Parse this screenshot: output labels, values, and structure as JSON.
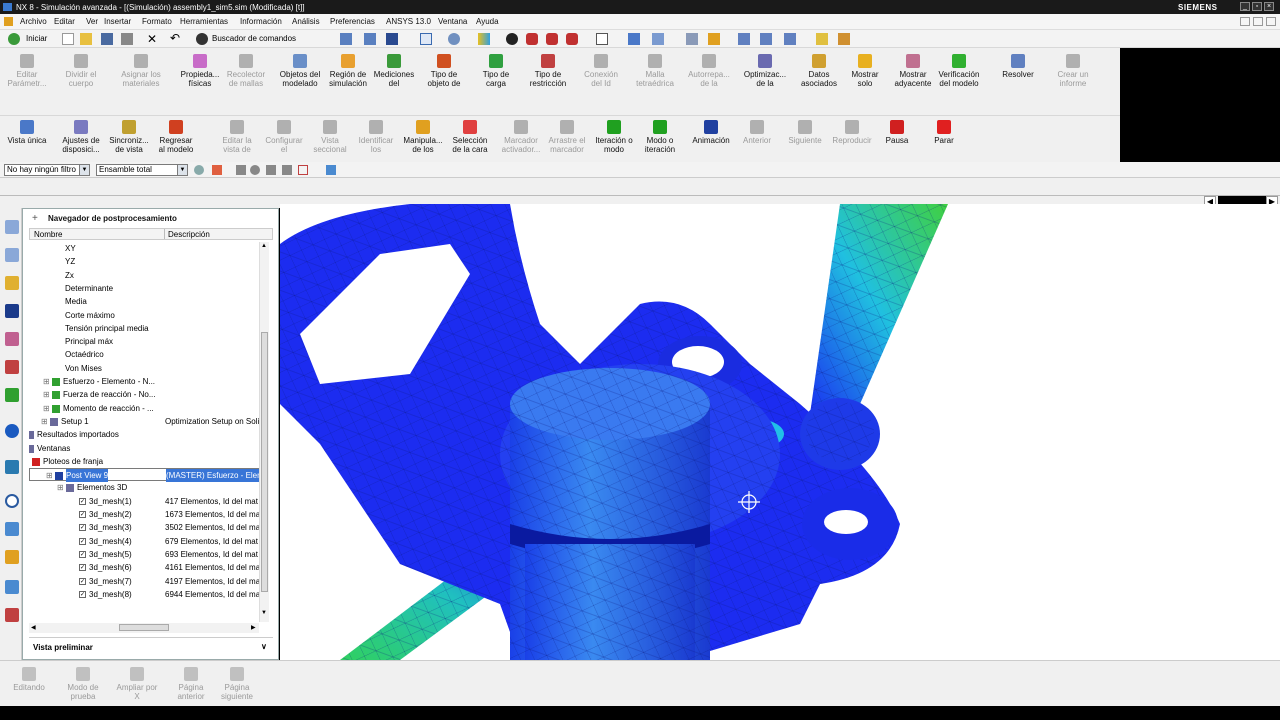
{
  "window": {
    "title": "NX 8 - Simulación avanzada - [(Simulación) assembly1_sim5.sim (Modificada)    [t]]",
    "brand": "SIEMENS"
  },
  "menu": [
    "Archivo",
    "Editar",
    "Ver",
    "Insertar",
    "Formato",
    "Herramientas",
    "Información",
    "Análisis",
    "Preferencias",
    "ANSYS 13.0",
    "Ventana",
    "Ayuda"
  ],
  "toolbar1": {
    "start": "Iniciar",
    "command_finder": "Buscador de comandos"
  },
  "ribbon1": [
    {
      "label": "Editar\nParámetr...",
      "enabled": false,
      "color": "#b0b0b0"
    },
    {
      "label": "Dividir el\ncuerpo",
      "enabled": false,
      "color": "#b0b0b0"
    },
    {
      "label": "Asignar los\nmateriales",
      "enabled": false,
      "color": "#b0b0b0"
    },
    {
      "label": "Propieda...\nfísicas",
      "enabled": true,
      "color": "#c86cc8"
    },
    {
      "label": "Recolector\nde mallas",
      "enabled": false,
      "color": "#b0b0b0"
    },
    {
      "label": "Objetos del\nmodelado",
      "enabled": true,
      "color": "#6a8fc8"
    },
    {
      "label": "Región de\nsimulación",
      "enabled": true,
      "color": "#e8a030"
    },
    {
      "label": "Mediciones\ndel",
      "enabled": true,
      "color": "#3a9a3a"
    },
    {
      "label": "Tipo de\nobjeto de",
      "enabled": true,
      "color": "#d05020"
    },
    {
      "label": "Tipo de\ncarga",
      "enabled": true,
      "color": "#30a040"
    },
    {
      "label": "Tipo de\nrestricción",
      "enabled": true,
      "color": "#c04040"
    },
    {
      "label": "Conexión\ndel Id",
      "enabled": false,
      "color": "#b0b0b0"
    },
    {
      "label": "Malla\ntetraédrica",
      "enabled": false,
      "color": "#b0b0b0"
    },
    {
      "label": "Autorrepa...\nde la",
      "enabled": false,
      "color": "#b0b0b0"
    },
    {
      "label": "Optimizac...\nde la",
      "enabled": true,
      "color": "#6a6ab0"
    },
    {
      "label": "Datos\nasociados",
      "enabled": true,
      "color": "#d0a030"
    },
    {
      "label": "Mostrar\nsolo",
      "enabled": true,
      "color": "#e8b020"
    },
    {
      "label": "Mostrar\nadyacente",
      "enabled": true,
      "color": "#c07090"
    },
    {
      "label": "Verificación\ndel modelo",
      "enabled": true,
      "color": "#30b030"
    },
    {
      "label": "Resolver",
      "enabled": true,
      "color": "#6080c0"
    },
    {
      "label": "Crear un\ninforme",
      "enabled": false,
      "color": "#b0b0b0"
    }
  ],
  "ribbon2": [
    {
      "label": "Vista única",
      "enabled": true,
      "color": "#4a78c8"
    },
    {
      "label": "Ajustes de\ndisposici...",
      "enabled": true,
      "color": "#7a7ac0"
    },
    {
      "label": "Sincroniz...\nde vista",
      "enabled": true,
      "color": "#c0a030"
    },
    {
      "label": "Regresar\nal modelo",
      "enabled": true,
      "color": "#d04020"
    },
    {
      "label": "Editar la\nvista de",
      "enabled": false,
      "color": "#b0b0b0"
    },
    {
      "label": "Configurar\nel",
      "enabled": false,
      "color": "#b0b0b0"
    },
    {
      "label": "Vista\nseccional",
      "enabled": false,
      "color": "#b0b0b0"
    },
    {
      "label": "Identificar\nlos",
      "enabled": false,
      "color": "#b0b0b0"
    },
    {
      "label": "Manipula...\nde los",
      "enabled": true,
      "color": "#e0a020"
    },
    {
      "label": "Selección\nde la cara",
      "enabled": true,
      "color": "#e04040"
    },
    {
      "label": "Marcador\nactivador...",
      "enabled": false,
      "color": "#b0b0b0"
    },
    {
      "label": "Arrastre el\nmarcador",
      "enabled": false,
      "color": "#b0b0b0"
    },
    {
      "label": "Iteración o\nmodo",
      "enabled": true,
      "color": "#20a020"
    },
    {
      "label": "Modo o\niteración",
      "enabled": true,
      "color": "#20a020"
    },
    {
      "label": "Animación",
      "enabled": true,
      "color": "#2040a0"
    },
    {
      "label": "Anterior",
      "enabled": false,
      "color": "#b0b0b0"
    },
    {
      "label": "Siguiente",
      "enabled": false,
      "color": "#b0b0b0"
    },
    {
      "label": "Reproducir",
      "enabled": false,
      "color": "#b0b0b0"
    },
    {
      "label": "Pausa",
      "enabled": true,
      "color": "#d02020"
    },
    {
      "label": "Parar",
      "enabled": true,
      "color": "#e02020"
    }
  ],
  "filter": {
    "filter_value": "No hay ningún filtro",
    "assembly_value": "Ensamble total"
  },
  "navigator": {
    "title": "Navegador de postprocesamiento",
    "col_name": "Nombre",
    "col_desc": "Descripción",
    "rows": [
      {
        "name": "XY",
        "desc": "",
        "indent": 36
      },
      {
        "name": "YZ",
        "desc": "",
        "indent": 36
      },
      {
        "name": "Zx",
        "desc": "",
        "indent": 36
      },
      {
        "name": "Determinante",
        "desc": "",
        "indent": 36
      },
      {
        "name": "Media",
        "desc": "",
        "indent": 36
      },
      {
        "name": "Corte máximo",
        "desc": "",
        "indent": 36
      },
      {
        "name": "Tensión principal media",
        "desc": "",
        "indent": 36
      },
      {
        "name": "Principal máx",
        "desc": "",
        "indent": 36
      },
      {
        "name": "Octaédrico",
        "desc": "",
        "indent": 36
      },
      {
        "name": "Von Mises",
        "desc": "",
        "indent": 36
      },
      {
        "name": "Esfuerzo - Elemento - N...",
        "desc": "",
        "indent": 34
      },
      {
        "name": "Fuerza de reacción - No...",
        "desc": "",
        "indent": 34
      },
      {
        "name": "Momento de reacción - ...",
        "desc": "",
        "indent": 34
      },
      {
        "name": "Setup 1",
        "desc": "Optimization Setup on Soli",
        "indent": 32
      },
      {
        "name": "Resultados importados",
        "desc": "",
        "indent": 8
      },
      {
        "name": "Ventanas",
        "desc": "",
        "indent": 8
      },
      {
        "name": "Ploteos de franja",
        "desc": "",
        "indent": 14
      },
      {
        "name": "Post View 9",
        "desc": "(MASTER) Esfuerzo - Elem",
        "indent": 36
      },
      {
        "name": "Elementos 3D",
        "desc": "",
        "indent": 48
      },
      {
        "name": "3d_mesh(1)",
        "desc": "417 Elementos, Id del mat",
        "indent": 60
      },
      {
        "name": "3d_mesh(2)",
        "desc": "1673 Elementos, Id del ma",
        "indent": 60
      },
      {
        "name": "3d_mesh(3)",
        "desc": "3502 Elementos, Id del ma",
        "indent": 60
      },
      {
        "name": "3d_mesh(4)",
        "desc": "679 Elementos, Id del mat",
        "indent": 60
      },
      {
        "name": "3d_mesh(5)",
        "desc": "693 Elementos, Id del mat",
        "indent": 60
      },
      {
        "name": "3d_mesh(6)",
        "desc": "4161 Elementos, Id del ma",
        "indent": 60
      },
      {
        "name": "3d_mesh(7)",
        "desc": "4197 Elementos, Id del ma",
        "indent": 60
      },
      {
        "name": "3d_mesh(8)",
        "desc": "6944 Elementos, Id del ma",
        "indent": 60
      }
    ],
    "preview": "Vista preliminar"
  },
  "bottom": [
    {
      "label": "Editando",
      "enabled": false
    },
    {
      "label": "Modo de\nprueba",
      "enabled": false
    },
    {
      "label": "Ampliar por\nX",
      "enabled": false
    },
    {
      "label": "Página\nanterior",
      "enabled": false
    },
    {
      "label": "Página\nsiguiente",
      "enabled": false
    }
  ]
}
